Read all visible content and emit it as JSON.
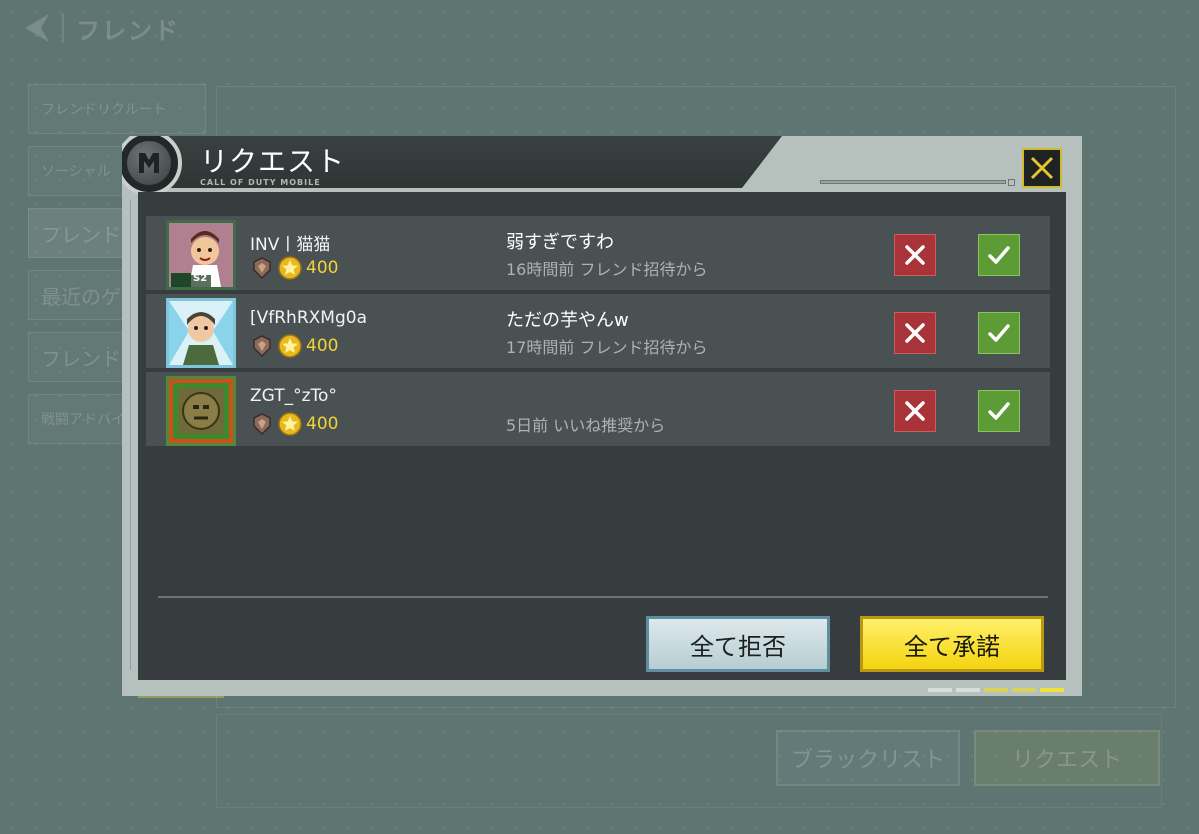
{
  "background": {
    "title": "フレンド",
    "menu": [
      "フレンドリクルート",
      "ソーシャル",
      "フレンド",
      "最近のゲ",
      "フレンド",
      "戦闘アドバイ"
    ],
    "buttons": {
      "blacklist": "ブラックリスト",
      "request": "リクエスト"
    }
  },
  "dialog": {
    "title": "リクエスト",
    "subtitle": "CALL OF DUTY MOBILE",
    "requests": [
      {
        "name": "INV丨猫猫",
        "points": "400",
        "message": "弱すぎですわ",
        "time": "16時間前 フレンド招待から",
        "avatar_badge": "S2"
      },
      {
        "name": "[VfRhRXMg0a",
        "points": "400",
        "message": "ただの芋やんw",
        "time": "17時間前 フレンド招待から"
      },
      {
        "name": "ZGT_°zTo°",
        "points": "400",
        "message": "",
        "time": "5日前 いいね推奨から"
      }
    ],
    "buttons": {
      "reject_all": "全て拒否",
      "accept_all": "全て承諾"
    }
  },
  "colors": {
    "reject": "#a8343a",
    "accept": "#5c9b35",
    "points": "#f3d23a",
    "accent": "#f4d40f"
  },
  "icons": [
    "back-chevron-icon",
    "codm-logo-icon",
    "close-icon",
    "reject-x-icon",
    "accept-check-icon",
    "rank-badge-icon",
    "star-coin-icon"
  ]
}
